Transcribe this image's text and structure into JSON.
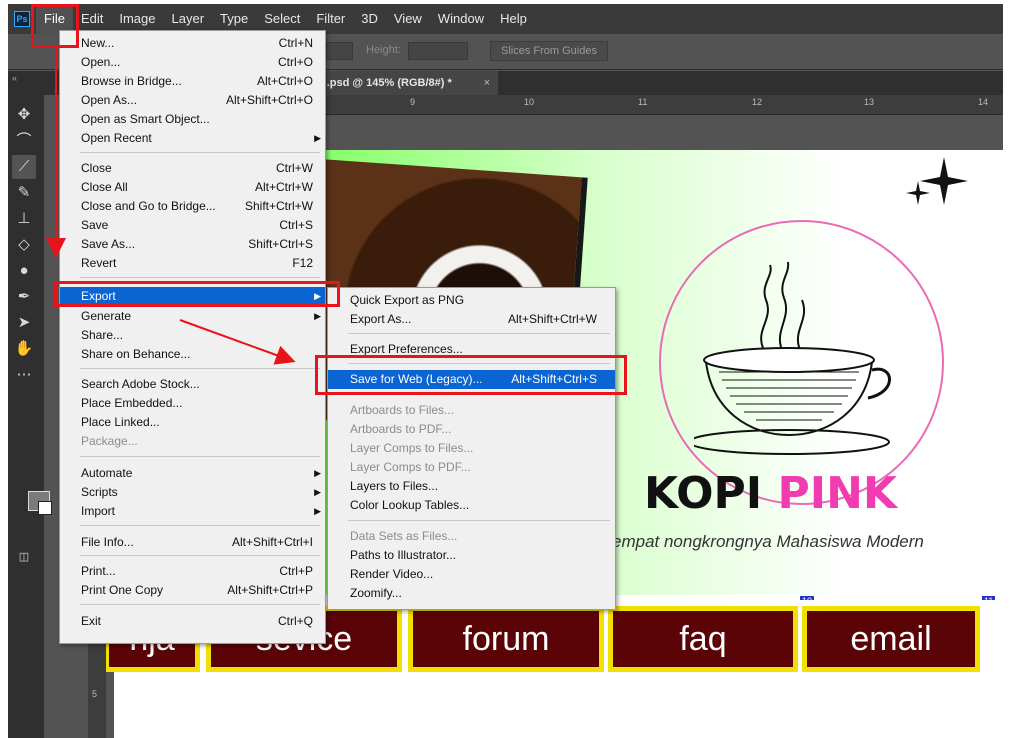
{
  "menubar": {
    "logo": "Ps",
    "items": [
      "File",
      "Edit",
      "Image",
      "Layer",
      "Type",
      "Select",
      "Filter",
      "3D",
      "View",
      "Window",
      "Help"
    ]
  },
  "options_bar": {
    "height_label": "Height:",
    "slices_button": "Slices From Guides"
  },
  "document_tab": {
    "title": "d.psd @ 145% (RGB/8#) *",
    "close": "×",
    "collapse": "«"
  },
  "ruler": {
    "h_labels": [
      "9",
      "10",
      "11",
      "12",
      "13",
      "14"
    ],
    "v_labels": [
      "5"
    ]
  },
  "file_menu": {
    "items": [
      {
        "label": "New...",
        "shortcut": "Ctrl+N"
      },
      {
        "label": "Open...",
        "shortcut": "Ctrl+O"
      },
      {
        "label": "Browse in Bridge...",
        "shortcut": "Alt+Ctrl+O"
      },
      {
        "label": "Open As...",
        "shortcut": "Alt+Shift+Ctrl+O"
      },
      {
        "label": "Open as Smart Object...",
        "shortcut": ""
      },
      {
        "label": "Open Recent",
        "shortcut": "",
        "submenu": true
      },
      {
        "label": "Close",
        "shortcut": "Ctrl+W"
      },
      {
        "label": "Close All",
        "shortcut": "Alt+Ctrl+W"
      },
      {
        "label": "Close and Go to Bridge...",
        "shortcut": "Shift+Ctrl+W"
      },
      {
        "label": "Save",
        "shortcut": "Ctrl+S"
      },
      {
        "label": "Save As...",
        "shortcut": "Shift+Ctrl+S"
      },
      {
        "label": "Revert",
        "shortcut": "F12"
      },
      {
        "label": "Export",
        "shortcut": "",
        "submenu": true,
        "highlighted": true
      },
      {
        "label": "Generate",
        "shortcut": "",
        "submenu": true
      },
      {
        "label": "Share...",
        "shortcut": ""
      },
      {
        "label": "Share on Behance...",
        "shortcut": ""
      },
      {
        "label": "Search Adobe Stock...",
        "shortcut": ""
      },
      {
        "label": "Place Embedded...",
        "shortcut": ""
      },
      {
        "label": "Place Linked...",
        "shortcut": ""
      },
      {
        "label": "Package...",
        "shortcut": "",
        "disabled": true
      },
      {
        "label": "Automate",
        "shortcut": "",
        "submenu": true
      },
      {
        "label": "Scripts",
        "shortcut": "",
        "submenu": true
      },
      {
        "label": "Import",
        "shortcut": "",
        "submenu": true
      },
      {
        "label": "File Info...",
        "shortcut": "Alt+Shift+Ctrl+I"
      },
      {
        "label": "Print...",
        "shortcut": "Ctrl+P"
      },
      {
        "label": "Print One Copy",
        "shortcut": "Alt+Shift+Ctrl+P"
      },
      {
        "label": "Exit",
        "shortcut": "Ctrl+Q"
      }
    ]
  },
  "export_submenu": {
    "items": [
      {
        "label": "Quick Export as PNG",
        "shortcut": ""
      },
      {
        "label": "Export As...",
        "shortcut": "Alt+Shift+Ctrl+W"
      },
      {
        "label": "Export Preferences...",
        "shortcut": ""
      },
      {
        "label": "Save for Web (Legacy)...",
        "shortcut": "Alt+Shift+Ctrl+S",
        "highlighted": true
      },
      {
        "label": "Artboards to Files...",
        "shortcut": "",
        "disabled": true
      },
      {
        "label": "Artboards to PDF...",
        "shortcut": "",
        "disabled": true
      },
      {
        "label": "Layer Comps to Files...",
        "shortcut": "",
        "disabled": true
      },
      {
        "label": "Layer Comps to PDF...",
        "shortcut": "",
        "disabled": true
      },
      {
        "label": "Layers to Files...",
        "shortcut": ""
      },
      {
        "label": "Color Lookup Tables...",
        "shortcut": ""
      },
      {
        "label": "Data Sets as Files...",
        "shortcut": "",
        "disabled": true
      },
      {
        "label": "Paths to Illustrator...",
        "shortcut": ""
      },
      {
        "label": "Render Video...",
        "shortcut": ""
      },
      {
        "label": "Zoomify...",
        "shortcut": ""
      }
    ]
  },
  "artwork": {
    "title_word1": "KOPI",
    "title_word2": "PINK",
    "tagline": "empat nongkrongnya Mahasiswa Modern",
    "nav": [
      "nja",
      "sevice",
      "forum",
      "faq",
      "email"
    ],
    "slice_numbers": [
      "10",
      "11"
    ]
  },
  "colors": {
    "accent": "#0a64d2",
    "annotation": "#e8141c",
    "brand_pink": "#f03cb0",
    "nav_button": "#5a0408",
    "nav_border": "#f2e000"
  }
}
